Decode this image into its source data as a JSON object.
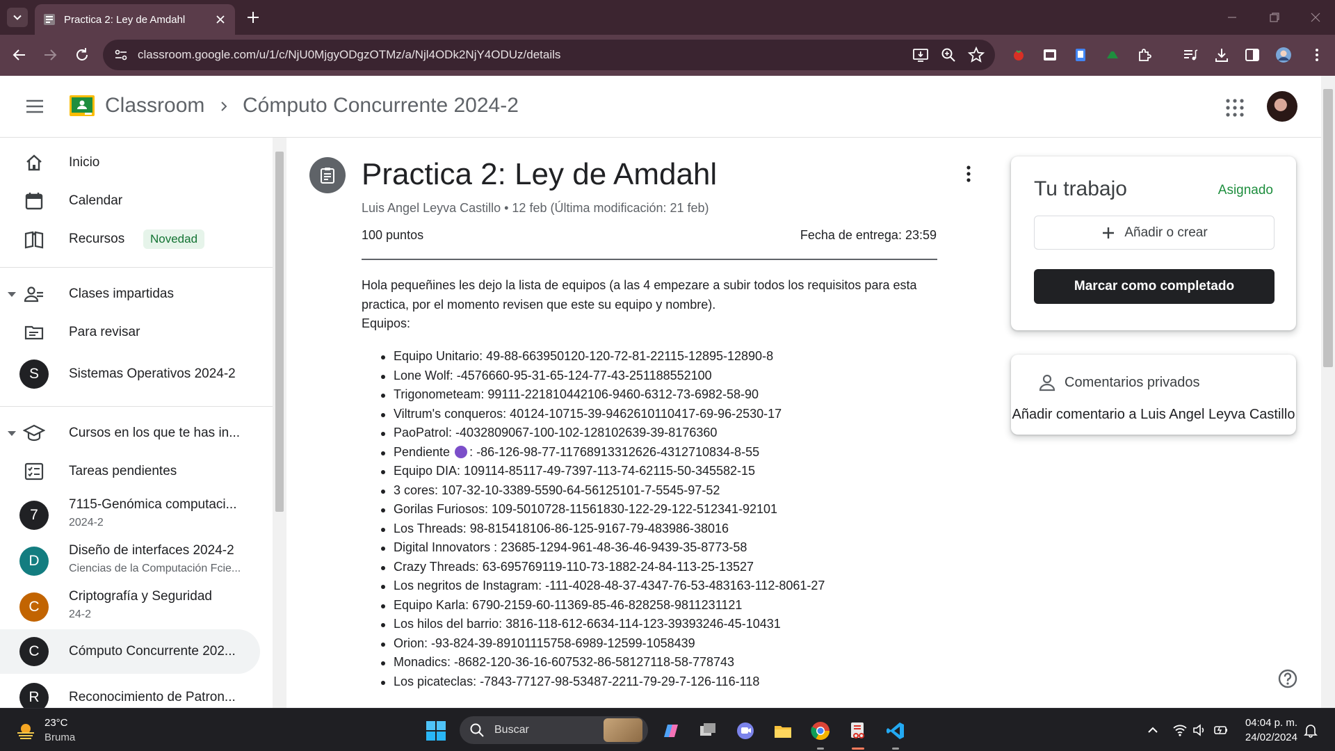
{
  "browser": {
    "tab_title": "Practica 2: Ley de Amdahl",
    "url": "classroom.google.com/u/1/c/NjU0MjgyODgzOTMz/a/Njl4ODk2NjY4ODUz/details"
  },
  "header": {
    "app_name": "Classroom",
    "course_name": "Cómputo Concurrente 2024-2"
  },
  "sidebar": {
    "home": "Inicio",
    "calendar": "Calendar",
    "resources": "Recursos",
    "resources_badge": "Novedad",
    "teaching": "Clases impartidas",
    "to_review": "Para revisar",
    "teaching_class": {
      "letter": "S",
      "name": "Sistemas Operativos 2024-2",
      "color": "#202124"
    },
    "enrolled": "Cursos en los que te has in...",
    "todo": "Tareas pendientes",
    "enrolled_classes": [
      {
        "letter": "7",
        "name": "7115-Genómica computaci...",
        "sub": "2024-2",
        "color": "#202124"
      },
      {
        "letter": "D",
        "name": "Diseño de interfaces 2024-2",
        "sub": "Ciencias de la Computación Fcie...",
        "color": "#137d80"
      },
      {
        "letter": "C",
        "name": "Criptografía y Seguridad",
        "sub": "24-2",
        "color": "#c26401"
      },
      {
        "letter": "C",
        "name": "Cómputo Concurrente 202...",
        "sub": "",
        "color": "#202124"
      },
      {
        "letter": "R",
        "name": "Reconocimiento de Patron...",
        "sub": "",
        "color": "#202124"
      }
    ]
  },
  "assignment": {
    "title": "Practica 2: Ley de Amdahl",
    "meta": "Luis Angel Leyva Castillo • 12 feb (Última modificación: 21 feb)",
    "points": "100 puntos",
    "due": "Fecha de entrega: 23:59",
    "description": "Hola pequeñines les dejo la lista de equipos (a las 4 empezare a subir todos los requisitos para esta practica, por el momento revisen que este su equipo y nombre).",
    "teams_heading": "Equipos:",
    "teams": [
      "Equipo Unitario: 49-88-663950120-120-72-81-22115-12895-12890-8",
      "Lone Wolf: -4576660-95-31-65-124-77-43-251188552100",
      "Trigonometeam: 99111-221810442106-9460-6312-73-6982-58-90",
      "Viltrum's conqueros: 40124-10715-39-9462610110417-69-96-2530-17",
      "PaoPatrol: -4032809067-100-102-128102639-39-8176360"
    ],
    "pending_team_name": "Pendiente ",
    "pending_team_value": ": -86-126-98-77-11768913312626-4312710834-8-55",
    "teams_after": [
      "Equipo DIA: 109114-85117-49-7397-113-74-62115-50-345582-15",
      "3 cores: 107-32-10-3389-5590-64-56125101-7-5545-97-52",
      "Gorilas Furiosos: 109-5010728-11561830-122-29-122-512341-92101",
      "Los Threads: 98-815418106-86-125-9167-79-483986-38016",
      "Digital Innovators : 23685-1294-961-48-36-46-9439-35-8773-58",
      "Crazy Threads: 63-695769119-110-73-1882-24-84-113-25-13527",
      "Los negritos de Instagram: -111-4028-48-37-4347-76-53-483163-112-8061-27",
      "Equipo Karla: 6790-2159-60-11369-85-46-828258-9811231121",
      "Los hilos del barrio: 3816-118-612-6634-114-123-39393246-45-10431",
      "Orion: -93-824-39-89101115758-6989-12599-1058439",
      "Monadics: -8682-120-36-16-607532-86-58127118-58-778743",
      "Los picateclas: -7843-77127-98-53487-2211-79-29-7-126-116-118"
    ]
  },
  "work_card": {
    "title": "Tu trabajo",
    "status": "Asignado",
    "add_label": "Añadir o crear",
    "complete_label": "Marcar como completado"
  },
  "comments_card": {
    "title": "Comentarios privados",
    "add_label": "Añadir comentario a Luis Angel Leyva Castillo"
  },
  "taskbar": {
    "temp": "23°C",
    "weather": "Bruma",
    "search_placeholder": "Buscar",
    "time": "04:04 p. m.",
    "date": "24/02/2024"
  },
  "colors": {
    "chrome_dark": "#3c2530",
    "chrome_toolbar": "#5a3c4a",
    "classroom_green": "#1e8e3e",
    "button_dark": "#202124"
  }
}
